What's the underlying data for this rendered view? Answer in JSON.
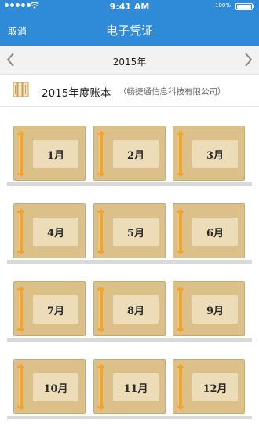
{
  "status": {
    "time": "9:41 AM",
    "battery": "100%"
  },
  "nav": {
    "cancel": "取消",
    "title": "电子凭证"
  },
  "year": {
    "label": "2015年"
  },
  "ledger": {
    "title": "2015年度账本",
    "company": "（畅捷通信息科技有限公司）"
  },
  "months": [
    "1月",
    "2月",
    "3月",
    "4月",
    "5月",
    "6月",
    "7月",
    "8月",
    "9月",
    "10月",
    "11月",
    "12月"
  ],
  "colors": {
    "accent": "#2f8bd8",
    "book": "#dcc08a",
    "binding": "#f0a52e",
    "label": "#ecdcb8"
  }
}
